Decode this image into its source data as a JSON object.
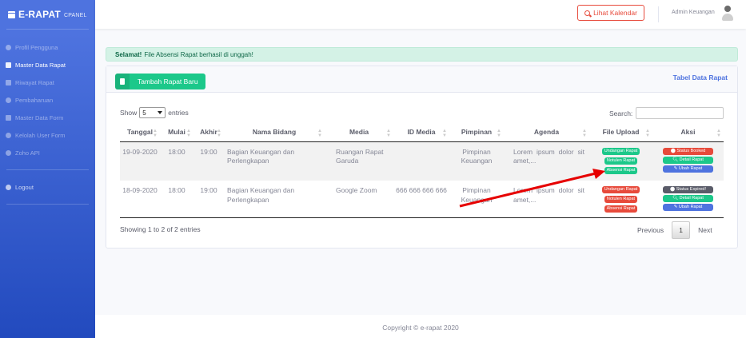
{
  "brand": {
    "title": "E-RAPAT",
    "subtitle": "CPANEL"
  },
  "sidebar": {
    "items": [
      {
        "label": "Profil Pengguna",
        "icon": "user-icon"
      },
      {
        "label": "Master Data Rapat",
        "icon": "calendar-icon",
        "active": true
      },
      {
        "label": "Riwayat Rapat",
        "icon": "history-icon"
      },
      {
        "label": "Pembaharuan",
        "icon": "refresh-icon"
      },
      {
        "label": "Master Data Form",
        "icon": "file-icon"
      },
      {
        "label": "Kelolah User Form",
        "icon": "users-icon"
      },
      {
        "label": "Zoho API",
        "icon": "link-icon"
      }
    ],
    "logout": "Logout"
  },
  "topbar": {
    "kalender_label": "Lihat Kalendar",
    "username": "Admin Keuangan"
  },
  "alert": {
    "strong": "Selamat!",
    "text": "File Absensi Rapat berhasil di unggah!"
  },
  "card": {
    "add_button": "Tambah Rapat Baru",
    "title": "Tabel Data Rapat",
    "show_prefix": "Show",
    "show_value": "5",
    "show_suffix": "entries",
    "search_label": "Search:",
    "showing_text": "Showing 1 to 2 of 2 entries",
    "pager": {
      "previous": "Previous",
      "page": "1",
      "next": "Next"
    }
  },
  "table": {
    "headers": [
      "Tanggal",
      "Mulai",
      "Akhir",
      "Nama Bidang",
      "Media",
      "ID Media",
      "Pimpinan",
      "Agenda",
      "File Upload",
      "Aksi"
    ],
    "rows": [
      {
        "tanggal": "19-09-2020",
        "mulai": "18:00",
        "akhir": "19:00",
        "bidang": "Bagian Keuangan dan Perlengkapan",
        "media": "Ruangan Rapat Garuda",
        "id_media": "",
        "pimpinan": "Pimpinan Keuangan",
        "agenda": "Lorem ipsum dolor sit amet,...",
        "files": [
          "Undangan Rapat",
          "Notulen Rapat",
          "Absensi Rapat"
        ],
        "file_colors": [
          "green",
          "green",
          "green"
        ],
        "aksi": [
          "Status Booked",
          "Detail Rapat",
          "Ubah Rapat"
        ]
      },
      {
        "tanggal": "18-09-2020",
        "mulai": "18:00",
        "akhir": "19:00",
        "bidang": "Bagian Keuangan dan Perlengkapan",
        "media": "Google Zoom",
        "id_media": "666 666 666 666",
        "pimpinan": "Pimpinan Keuangan",
        "agenda": "Lorem ipsum dolor sit amet,...",
        "files": [
          "Undangan Rapat",
          "Notulen Rapat",
          "Absensi Rapat"
        ],
        "file_colors": [
          "red",
          "red",
          "red"
        ],
        "aksi": [
          "Status Expired!",
          "Detail Rapat",
          "Ubah Rapat"
        ]
      }
    ]
  },
  "footer": {
    "copyright": "Copyright © e-rapat 2020"
  },
  "colors": {
    "primary": "#4e73df",
    "success": "#1cc88a",
    "danger": "#e74a3b",
    "secondary": "#5a5c69",
    "annotation": "#e60000"
  }
}
